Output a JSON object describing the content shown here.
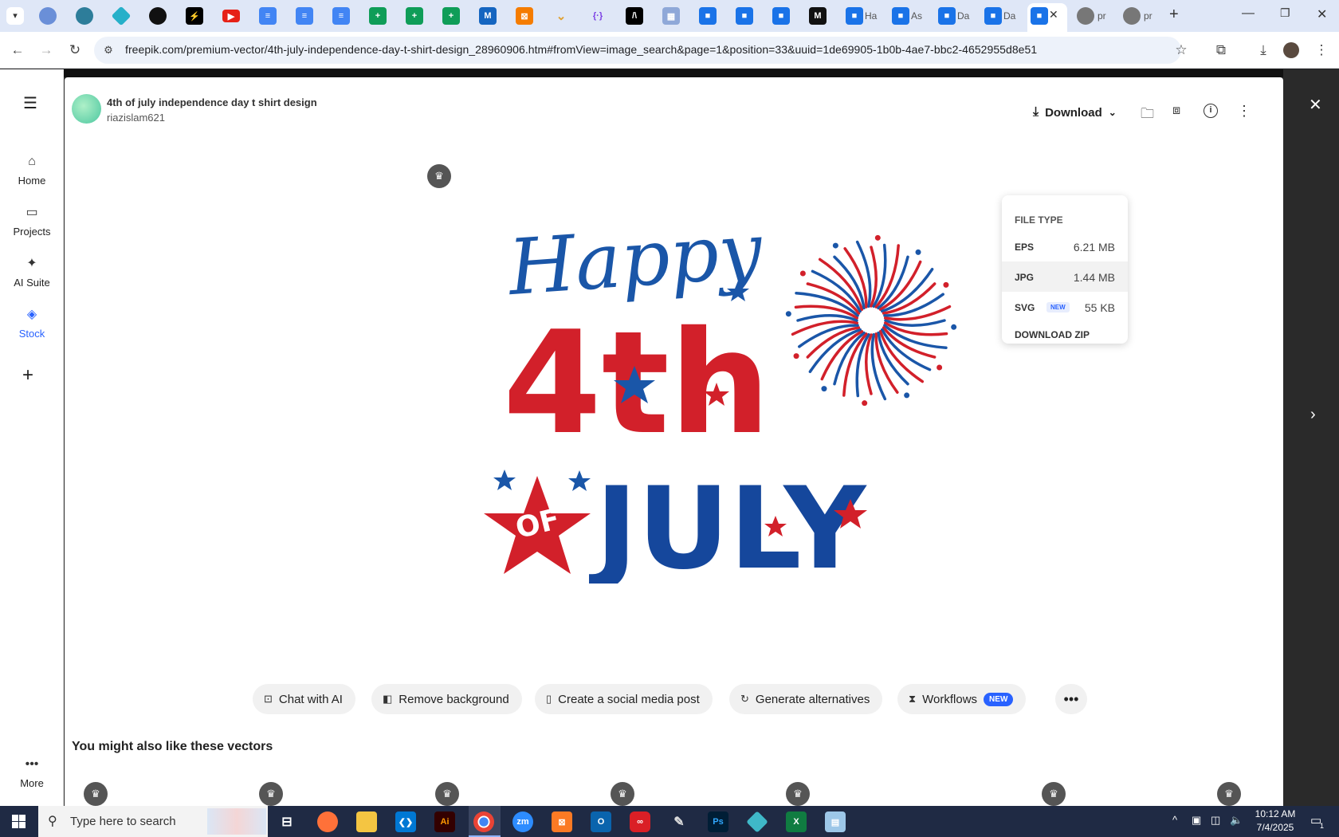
{
  "browser": {
    "tabs": [
      {
        "title": "Ha"
      },
      {
        "title": "As"
      },
      {
        "title": "Da"
      },
      {
        "title": "Da"
      },
      {
        "title": "",
        "active": true
      },
      {
        "title": "pr"
      },
      {
        "title": "pr"
      }
    ],
    "url": "freepik.com/premium-vector/4th-july-independence-day-t-shirt-design_28960906.htm#fromView=image_search&page=1&position=33&uuid=1de69905-1b0b-4ae7-bbc2-4652955d8e51"
  },
  "sidebar": {
    "items": [
      {
        "label": "Home",
        "icon": "home-icon"
      },
      {
        "label": "Projects",
        "icon": "projects-icon"
      },
      {
        "label": "AI Suite",
        "icon": "sparkle-icon"
      },
      {
        "label": "Stock",
        "icon": "stock-icon",
        "active": true
      },
      {
        "label": "",
        "icon": "plus-icon"
      },
      {
        "label": "More",
        "icon": "more-dots-icon"
      }
    ]
  },
  "asset": {
    "title": "4th of july independence day t shirt design",
    "author": "riazislam621",
    "artwork": {
      "line1": "Happy",
      "line2": "4th",
      "line3": "OF",
      "line4": "JULY",
      "colors": {
        "red": "#d2202a",
        "blue": "#1a56a8",
        "navy": "#15479c"
      }
    }
  },
  "header_actions": {
    "download_label": "Download"
  },
  "download_menu": {
    "heading": "FILE TYPE",
    "options": [
      {
        "type": "EPS",
        "size": "6.21 MB",
        "badge": ""
      },
      {
        "type": "JPG",
        "size": "1.44 MB",
        "badge": "",
        "highlighted": true
      },
      {
        "type": "SVG",
        "size": "55 KB",
        "badge": "NEW"
      }
    ],
    "zip_label": "DOWNLOAD ZIP"
  },
  "tools": [
    {
      "label": "Chat with AI",
      "icon": "chat-ai-icon"
    },
    {
      "label": "Remove background",
      "icon": "remove-bg-icon"
    },
    {
      "label": "Create a social media post",
      "icon": "phone-icon"
    },
    {
      "label": "Generate alternatives",
      "icon": "refresh-icon"
    },
    {
      "label": "Workflows",
      "icon": "workflows-icon",
      "badge": "NEW"
    }
  ],
  "related": {
    "heading": "You might also like these vectors"
  },
  "taskbar": {
    "search_placeholder": "Type here to search",
    "time": "10:12 AM",
    "date": "7/4/2025",
    "notification_count": "1"
  },
  "theme": {
    "accent": "#2962ff",
    "stock_active": "#2962ff"
  }
}
